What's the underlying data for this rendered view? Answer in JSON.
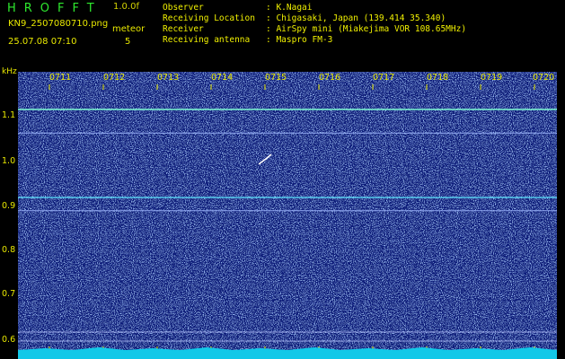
{
  "header": {
    "app_title": "HROFFT",
    "version": "1.0.0f",
    "file_name": "KN9_2507080710.png",
    "mode_label": "meteor",
    "datetime": "25.07.08 07:10",
    "meteor_count": "5"
  },
  "info": [
    {
      "key": "Observer",
      "value": ": K.Nagai"
    },
    {
      "key": "Receiving Location",
      "value": ": Chigasaki, Japan (139.414 35.340)"
    },
    {
      "key": "Receiver",
      "value": ": AirSpy mini (Miakejima VOR 108.65MHz)"
    },
    {
      "key": "Receiving antenna",
      "value": ": Maspro FM-3"
    }
  ],
  "spectrogram": {
    "y_unit": "kHz",
    "y_ticks": [
      "1.1",
      "1.0",
      "0.9",
      "0.8",
      "0.7",
      "0.6"
    ],
    "y_range": [
      0.575,
      1.185
    ],
    "x_ticks": [
      "0711",
      "0712",
      "0713",
      "0714",
      "0715",
      "0716",
      "0717",
      "0718",
      "0719",
      "0720"
    ],
    "x_range": [
      0,
      10
    ],
    "background_color": "#0a1c7a",
    "carriers_khz": [
      1.105,
      1.055,
      0.918,
      0.89
    ]
  }
}
